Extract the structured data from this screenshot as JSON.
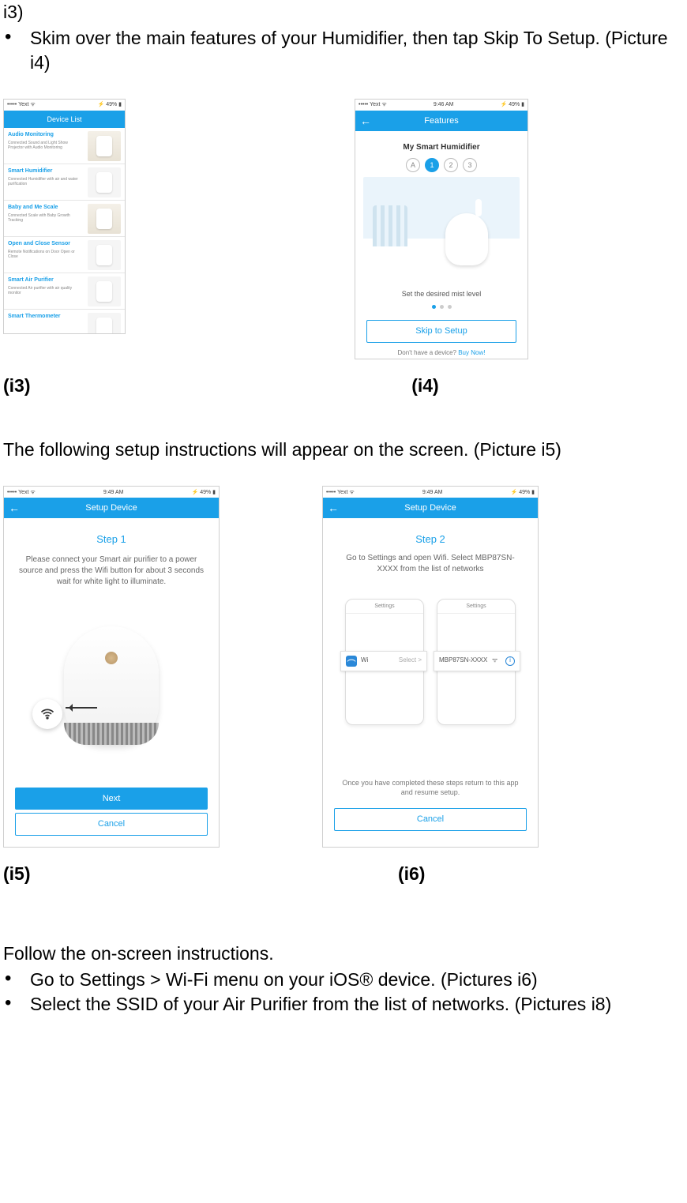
{
  "intro": {
    "line1": "i3)",
    "bullet1": "Skim over the main features of your Humidifier, then tap Skip To Setup. (Picture i4)"
  },
  "captions": {
    "i3": "(i3)",
    "i4": "(i4)",
    "i5": "(i5)",
    "i6": "(i6)"
  },
  "mid_text": "The following setup instructions will appear on the screen. (Picture i5)",
  "outro": {
    "line1": "Follow the on-screen instructions.",
    "bullet1": "Go to Settings > Wi-Fi menu on your iOS® device. (Pictures i6)",
    "bullet2": "Select the SSID of your Air Purifier from the list of networks. (Pictures i8)"
  },
  "status": {
    "carrier": "••••• Yext  ᯤ",
    "time946": "9:46 AM",
    "time949": "9:49 AM",
    "batt": "⚡ 49% ▮"
  },
  "i3": {
    "title": "Device List",
    "items": [
      {
        "title": "Audio Monitoring",
        "desc": "Connected Sound and Light Show Projector with Audio Monitoring"
      },
      {
        "title": "Smart Humidifier",
        "desc": "Connected Humidifier with air and water purification"
      },
      {
        "title": "Baby and Me Scale",
        "desc": "Connected Scale with Baby Growth Tracking"
      },
      {
        "title": "Open and Close Sensor",
        "desc": "Remote Notifications on Door Open or Close"
      },
      {
        "title": "Smart Air Purifier",
        "desc": "Connected Air purifier with air quality monitor"
      },
      {
        "title": "Smart Thermometer",
        "desc": ""
      }
    ]
  },
  "i4": {
    "title": "Features",
    "sub": "My Smart Humidifier",
    "steps": [
      "1",
      "2",
      "3"
    ],
    "stepA": "A",
    "scenelabel": "Set the desired mist level",
    "button": "Skip to Setup",
    "footnote": "Don't have a device? ",
    "footlink": "Buy Now!"
  },
  "i5": {
    "title": "Setup Device",
    "step": "Step 1",
    "inst": "Please connect your Smart air purifier to a power source and press the Wifi button for about 3 seconds wait for white light to illuminate.",
    "next": "Next",
    "cancel": "Cancel"
  },
  "i6": {
    "title": "Setup Device",
    "step": "Step 2",
    "inst": "Go to Settings and open Wifi. Select MBP87SN-XXXX from the list of networks",
    "settings": "Settings",
    "wifi": "Wi",
    "select": "Select  >",
    "ssid": "MBP87SN-XXXX",
    "wicon": "ᯤ",
    "note": "Once you have completed these steps return to this app and resume setup.",
    "cancel": "Cancel"
  }
}
